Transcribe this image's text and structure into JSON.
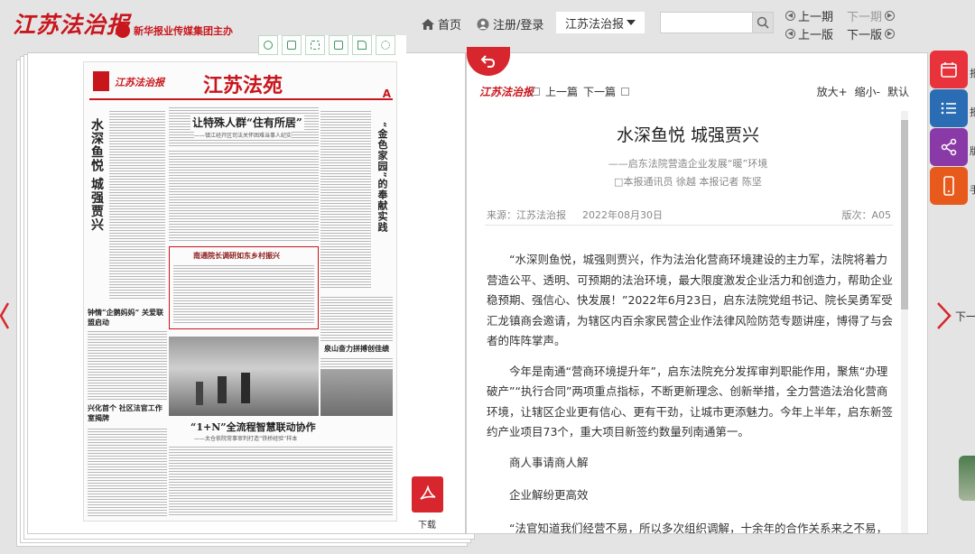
{
  "header": {
    "logo_text": "江苏法治报",
    "org_name": "新华报业传媒集团主办",
    "nav": {
      "home": "首页",
      "login": "注册/登录"
    },
    "paper_select": "江苏法治报",
    "search": {
      "value": "",
      "placeholder": ""
    },
    "pager": {
      "prev_issue": "上一期",
      "next_issue": "下一期",
      "prev_page": "上一版",
      "next_page": "下一版"
    }
  },
  "toolbar_icons": [
    "zoom-icon",
    "single-page-icon",
    "fullscreen-icon",
    "save-icon",
    "share-icon",
    "settings-icon"
  ],
  "newspaper": {
    "masthead": "江苏法治报",
    "section": "江苏法苑",
    "page_letter": "A",
    "left_title": "水深鱼悦 城强贾兴",
    "h1": "让特殊人群“住有所居”",
    "h1_sub": "——镇江经开区司法关怀困难当事人纪实",
    "h2": "南通院长调研如东乡村振兴",
    "h3": "钟情“企鹅妈妈” 关爱联盟启动",
    "h4": "“金色家园”的奉献实践",
    "h5": "泉山奋力拼搏创佳绩",
    "h6": "兴化首个 社区法官工作室揭牌",
    "h7": "“1+N”全流程智慧联动协作",
    "h7_sub": "——太仓依院常事审判打造“铁桥经验”样本"
  },
  "download_label": "下载",
  "article": {
    "logo": "江苏法治报",
    "prev_article": "上一篇",
    "next_article": "下一篇",
    "zoom_in": "放大+",
    "zoom_out": "缩小-",
    "default": "默认",
    "title": "水深鱼悦 城强贾兴",
    "subtitle": "——启东法院营造企业发展“暖”环境",
    "byline": "□本报通讯员 徐越 本报记者 陈坚",
    "source": "来源：江苏法治报",
    "date": "2022年08月30日",
    "page_version": "版次：A05",
    "paragraphs": [
      "“水深则鱼悦，城强则贾兴，作为法治化营商环境建设的主力军，法院将着力营造公平、透明、可预期的法治环境，最大限度激发企业活力和创造力，帮助企业稳预期、强信心、快发展！”2022年6月23日，启东法院党组书记、院长吴勇军受汇龙镇商会邀请，为辖区内百余家民营企业作法律风险防范专题讲座，博得了与会者的阵阵掌声。",
      "今年是南通“营商环境提升年”，启东法院充分发挥审判职能作用，聚焦“办理破产”“执行合同”两项重点指标，不断更新理念、创新举措，全力营造法治化营商环境，让辖区企业更有信心、更有干劲，让城市更添魅力。今年上半年，启东新签约产业项目73个，重大项目新签约数量列南通第一。",
      "商人事请商人解",
      "企业解纷更高效",
      "“法官知道我们经营不易，所以多次组织调解，十余年的合作关系来之不易，"
    ]
  },
  "next_page_label": "下一版",
  "side_tools": [
    {
      "icon": "calendar-icon",
      "label": "报",
      "color": "#e8323c"
    },
    {
      "icon": "list-icon",
      "label": "报",
      "color": "#2a6db5"
    },
    {
      "icon": "share-icon",
      "label": "版",
      "color": "#8a3aa6"
    },
    {
      "icon": "mobile-icon",
      "label": "手",
      "color": "#e85a1c"
    }
  ]
}
